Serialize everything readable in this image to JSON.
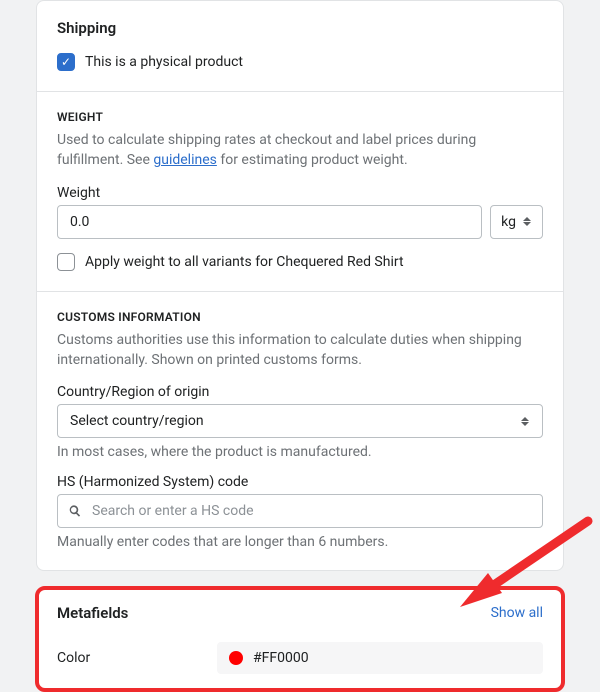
{
  "shipping": {
    "title": "Shipping",
    "physical_label": "This is a physical product",
    "physical_checked": true,
    "weight": {
      "heading": "WEIGHT",
      "desc_prefix": "Used to calculate shipping rates at checkout and label prices during fulfillment. See ",
      "guidelines_link": "guidelines",
      "desc_suffix": " for estimating product weight.",
      "label": "Weight",
      "value": "0.0",
      "unit": "kg",
      "apply_label": "Apply weight to all variants for Chequered Red Shirt",
      "apply_checked": false
    },
    "customs": {
      "heading": "CUSTOMS INFORMATION",
      "desc": "Customs authorities use this information to calculate duties when shipping internationally. Shown on printed customs forms.",
      "country_label": "Country/Region of origin",
      "country_value": "Select country/region",
      "country_helper": "In most cases, where the product is manufactured.",
      "hs_label": "HS (Harmonized System) code",
      "hs_placeholder": "Search or enter a HS code",
      "hs_helper": "Manually enter codes that are longer than 6 numbers."
    }
  },
  "metafields": {
    "title": "Metafields",
    "show_all": "Show all",
    "row": {
      "key": "Color",
      "hex": "#FF0000"
    }
  },
  "annotation": {
    "color": "#ef2b2d"
  }
}
